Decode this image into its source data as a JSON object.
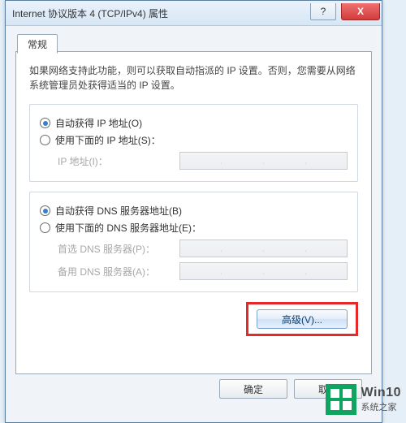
{
  "dialog": {
    "title": "Internet 协议版本 4 (TCP/IPv4) 属性",
    "help_glyph": "?",
    "close_glyph": "X"
  },
  "tab": {
    "label": "常规"
  },
  "intro": "如果网络支持此功能，则可以获取自动指派的 IP 设置。否则，您需要从网络系统管理员处获得适当的 IP 设置。",
  "ip_group": {
    "opt_auto": "自动获得 IP 地址(O)",
    "opt_manual": "使用下面的 IP 地址(S)：",
    "field_ip": "IP 地址(I)："
  },
  "dns_group": {
    "opt_auto": "自动获得 DNS 服务器地址(B)",
    "opt_manual": "使用下面的 DNS 服务器地址(E)：",
    "field_pref": "首选 DNS 服务器(P)：",
    "field_alt": "备用 DNS 服务器(A)："
  },
  "buttons": {
    "advanced": "高级(V)...",
    "ok": "确定",
    "cancel": "取消"
  },
  "watermark": {
    "line1": "Win10",
    "line2": "系统之家"
  }
}
